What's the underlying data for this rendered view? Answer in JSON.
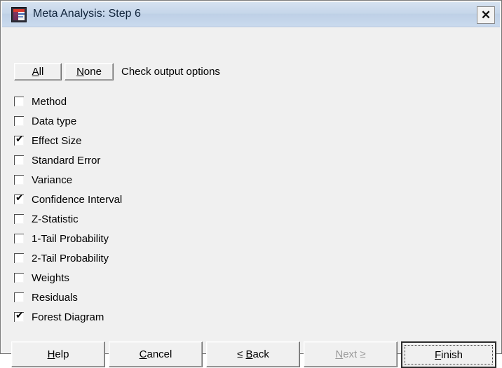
{
  "window": {
    "title": "Meta Analysis: Step 6",
    "icon": "meta-analysis-icon",
    "close_label": "✕",
    "frame_color": "#7a7a7a",
    "panel_color": "#f0f0f0",
    "titlebar_color": "#c6d6ea"
  },
  "toolbar": {
    "all_label": "All",
    "all_accel": "A",
    "none_label": "None",
    "none_accel": "N",
    "hint": "Check output options"
  },
  "options": [
    {
      "label": "Method",
      "checked": false
    },
    {
      "label": "Data type",
      "checked": false
    },
    {
      "label": "Effect Size",
      "checked": true
    },
    {
      "label": "Standard Error",
      "checked": false
    },
    {
      "label": "Variance",
      "checked": false
    },
    {
      "label": "Confidence Interval",
      "checked": true
    },
    {
      "label": "Z-Statistic",
      "checked": false
    },
    {
      "label": "1-Tail Probability",
      "checked": false
    },
    {
      "label": "2-Tail Probability",
      "checked": false
    },
    {
      "label": "Weights",
      "checked": false
    },
    {
      "label": "Residuals",
      "checked": false
    },
    {
      "label": "Forest Diagram",
      "checked": true
    }
  ],
  "check_glyph": "✔",
  "footer": {
    "help": {
      "pre": "",
      "accel": "H",
      "post": "elp",
      "disabled": false,
      "default": false
    },
    "cancel": {
      "pre": "",
      "accel": "C",
      "post": "ancel",
      "disabled": false,
      "default": false
    },
    "back": {
      "pre": "≤ ",
      "accel": "B",
      "post": "ack",
      "disabled": false,
      "default": false
    },
    "next": {
      "pre": "",
      "accel": "N",
      "post": "ext ≥",
      "disabled": true,
      "default": false
    },
    "finish": {
      "pre": "",
      "accel": "F",
      "post": "inish",
      "disabled": false,
      "default": true
    }
  }
}
